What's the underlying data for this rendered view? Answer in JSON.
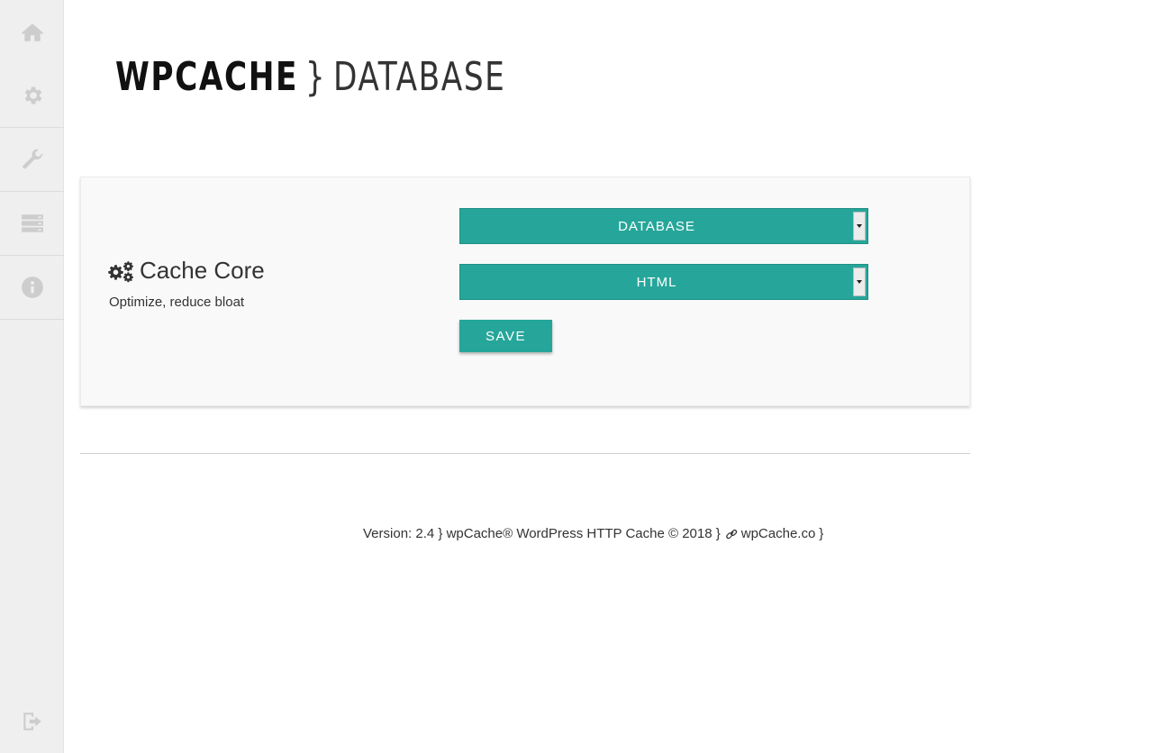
{
  "sidebar": {
    "items": [
      {
        "icon": "home-icon"
      },
      {
        "icon": "gear-icon"
      },
      {
        "icon": "wrench-icon"
      },
      {
        "icon": "server-icon"
      },
      {
        "icon": "info-icon"
      }
    ],
    "bottom": {
      "icon": "sign-out-icon"
    }
  },
  "header": {
    "title_main": "WPCACHE",
    "title_sep": "}",
    "title_section": "DATABASE"
  },
  "card": {
    "icon": "gears-icon",
    "title": "Cache Core",
    "subtitle": "Optimize, reduce bloat",
    "select_primary": {
      "value": "DATABASE"
    },
    "select_secondary": {
      "value": "HTML"
    },
    "save_label": "SAVE"
  },
  "footer": {
    "version_text": "Version: 2.4 } wpCache® WordPress HTTP Cache © 2018 }",
    "link_icon": "link-icon",
    "link_text": "wpCache.co",
    "closing": "}"
  },
  "colors": {
    "accent": "#26a69a",
    "sidebar_bg": "#efefef",
    "icon_gray": "#cdcdcd"
  }
}
